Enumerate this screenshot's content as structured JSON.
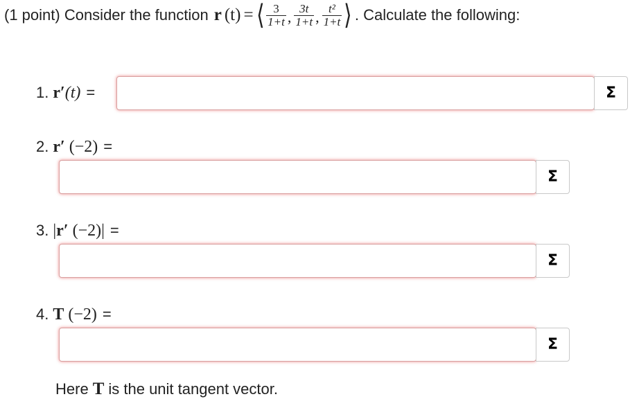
{
  "problem": {
    "intro": "(1 point) Consider the function",
    "function_name": "r",
    "variable": "(t)",
    "equals": "=",
    "components": [
      {
        "numerator": "3",
        "denominator": "1+t"
      },
      {
        "numerator": "3t",
        "denominator": "1+t"
      },
      {
        "numerator": "t²",
        "denominator": "1+t"
      }
    ],
    "separator": ",",
    "left_angle": "⟨",
    "right_angle": "⟩",
    "trailing": ". Calculate the following:"
  },
  "questions": [
    {
      "number": "1.",
      "symbol": "r′",
      "argument": "(t)",
      "prefix": "",
      "suffix": "",
      "equals": "=",
      "value": ""
    },
    {
      "number": "2.",
      "symbol": "r′",
      "argument": " (−2)",
      "prefix": "",
      "suffix": "",
      "equals": "=",
      "value": ""
    },
    {
      "number": "3.",
      "symbol": "r′",
      "argument": " (−2)",
      "prefix": "|",
      "suffix": "|",
      "equals": "=",
      "value": ""
    },
    {
      "number": "4.",
      "symbol": "T",
      "argument": " (−2)",
      "prefix": "",
      "suffix": "",
      "equals": "=",
      "value": ""
    }
  ],
  "equation_editor_label": "Σ",
  "footnote": {
    "before": "Here",
    "symbol": "T",
    "after": "is the unit tangent vector."
  },
  "colors": {
    "error_border": "#d9a0a0",
    "error_glow": "#dc2828",
    "text": "#222222"
  },
  "icons": {
    "equation_editor": "sigma-icon"
  }
}
